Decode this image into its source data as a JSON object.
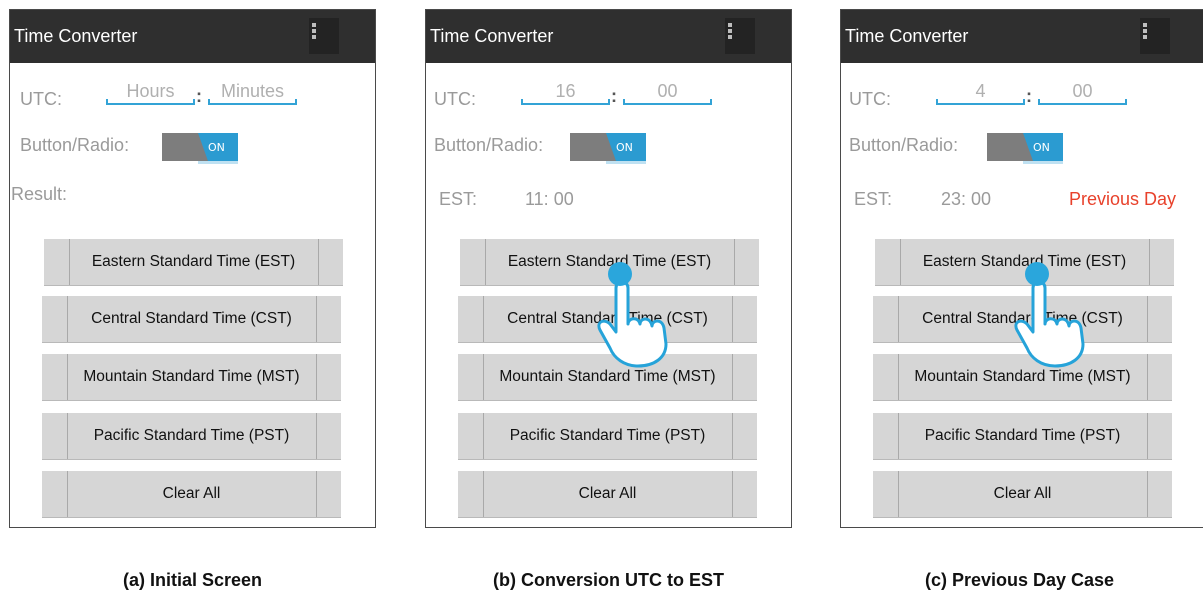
{
  "app_title": "Time Converter",
  "labels": {
    "utc": "UTC:",
    "button_radio": "Button/Radio:",
    "result": "Result:",
    "est": "EST:",
    "toggle_on": "ON"
  },
  "buttons": [
    "Eastern Standard Time (EST)",
    "Central Standard Time (CST)",
    "Mountain Standard Time (MST)",
    "Pacific Standard Time (PST)",
    "Clear All"
  ],
  "panels": [
    {
      "hours": "Hours",
      "minutes": "Minutes",
      "caption": "(a) Initial Screen"
    },
    {
      "hours": "16",
      "minutes": "00",
      "est_value": "11: 00",
      "caption": "(b) Conversion UTC to EST"
    },
    {
      "hours": "4",
      "minutes": "00",
      "est_value": "23: 00",
      "day_note": "Previous Day",
      "caption": "(c) Previous Day Case"
    }
  ],
  "colors": {
    "titlebar": "#2f2f2f",
    "accent": "#33a3d6",
    "warning": "#e8412b",
    "button": "#d6d6d6"
  },
  "icons": [
    "overflow-menu-icon",
    "tap-hand-icon"
  ]
}
